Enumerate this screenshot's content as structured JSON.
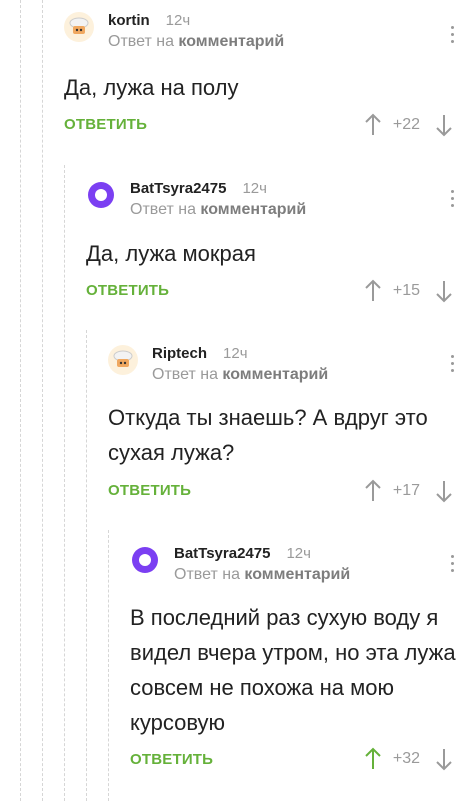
{
  "comments": [
    {
      "author": "kortin",
      "time": "12ч",
      "reply_prefix": "Ответ на",
      "reply_target": "комментарий",
      "text": "Да, лужа на полу",
      "reply_label": "ОТВЕТИТЬ",
      "score": "+22",
      "avatar": "chef-hat-icon",
      "up_active": false
    },
    {
      "author": "BatTsyra2475",
      "time": "12ч",
      "reply_prefix": "Ответ на",
      "reply_target": "комментарий",
      "text": "Да, лужа мокрая",
      "reply_label": "ОТВЕТИТЬ",
      "score": "+15",
      "avatar": "alice-icon",
      "up_active": false
    },
    {
      "author": "Riptech",
      "time": "12ч",
      "reply_prefix": "Ответ на",
      "reply_target": "комментарий",
      "text": "Откуда ты знаешь? А вдруг это сухая лужа?",
      "reply_label": "ОТВЕТИТЬ",
      "score": "+17",
      "avatar": "chef-hat-icon",
      "up_active": false
    },
    {
      "author": "BatTsyra2475",
      "time": "12ч",
      "reply_prefix": "Ответ на",
      "reply_target": "комментарий",
      "text": "В последний раз сухую воду я видел вчера утром, но эта лужа совсем не похожа на мою курсовую",
      "reply_label": "ОТВЕТИТЬ",
      "score": "+32",
      "avatar": "alice-icon",
      "up_active": true
    }
  ],
  "colors": {
    "accent": "#65b13a",
    "muted": "#9a9a9a",
    "text": "#222222",
    "alice": "#7b3ff2"
  }
}
